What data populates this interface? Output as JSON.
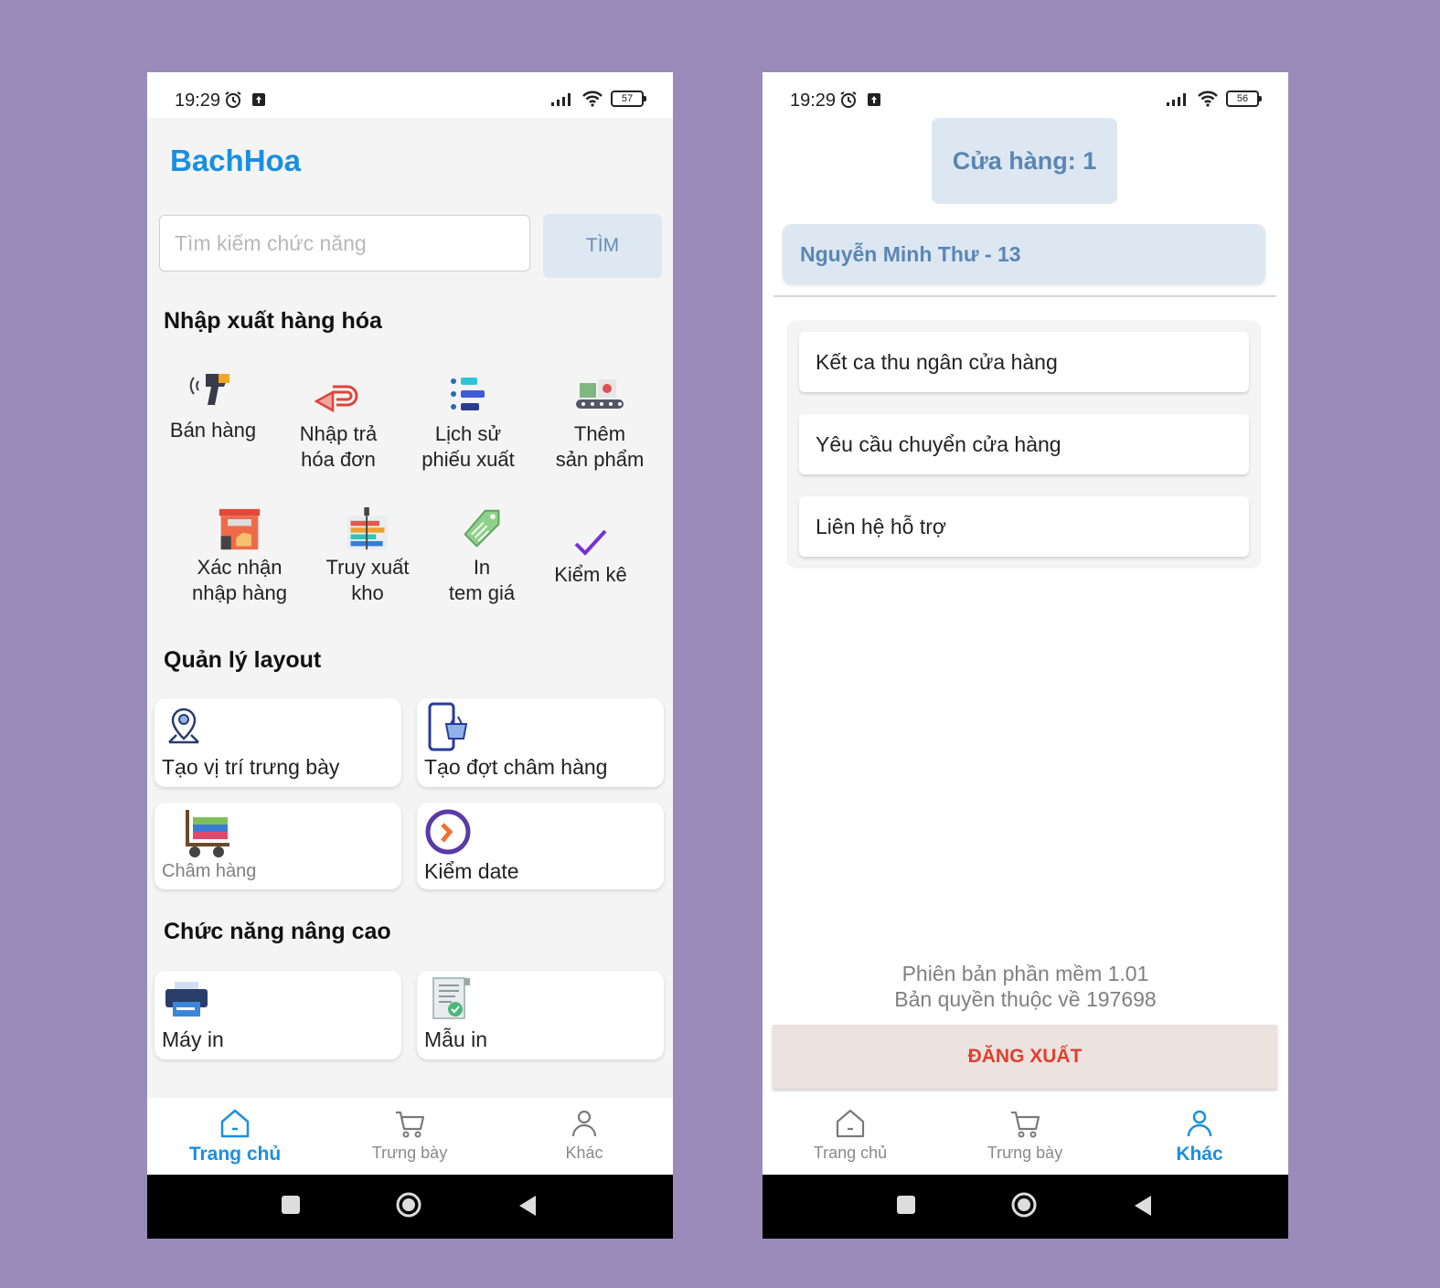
{
  "screens": {
    "home": {
      "status": {
        "time": "19:29",
        "battery": "57"
      },
      "app_title": "BachHoa",
      "search": {
        "placeholder": "Tìm kiếm chức năng",
        "button_label": "TÌM"
      },
      "sections": {
        "import_export": {
          "title": "Nhập xuất hàng hóa",
          "items": [
            {
              "label": "Bán hàng",
              "icon": "barcode-scanner-icon"
            },
            {
              "label": "Nhập trả\nhóa đơn",
              "icon": "return-arrow-icon"
            },
            {
              "label": "Lịch sử\nphiếu xuất",
              "icon": "history-list-icon"
            },
            {
              "label": "Thêm\nsản phẩm",
              "icon": "conveyor-icon"
            },
            {
              "label": "Xác nhận\nnhập hàng",
              "icon": "warehouse-icon"
            },
            {
              "label": "Truy xuất\nkho",
              "icon": "shelf-icon"
            },
            {
              "label": "In\ntem giá",
              "icon": "price-tag-icon"
            },
            {
              "label": "Kiểm kê",
              "icon": "checkmark-icon"
            }
          ]
        },
        "layout": {
          "title": "Quản lý layout",
          "cards": [
            {
              "label": "Tạo vị trí trưng bày",
              "icon": "map-pin-user-icon"
            },
            {
              "label": "Tạo đợt châm hàng",
              "icon": "phone-basket-icon"
            },
            {
              "label": "Châm hàng",
              "icon": "hand-truck-icon"
            },
            {
              "label": "Kiểm date",
              "icon": "clock-icon"
            }
          ]
        },
        "advanced": {
          "title": "Chức năng nâng cao",
          "cards": [
            {
              "label": "Máy in",
              "icon": "printer-icon"
            },
            {
              "label": "Mẫu in",
              "icon": "receipt-template-icon"
            }
          ]
        }
      },
      "nav": [
        {
          "label": "Trang chủ",
          "icon": "home-icon",
          "active": true
        },
        {
          "label": "Trưng bày",
          "icon": "cart-icon",
          "active": false
        },
        {
          "label": "Khác",
          "icon": "user-icon",
          "active": false
        }
      ]
    },
    "other": {
      "status": {
        "time": "19:29",
        "battery": "56"
      },
      "store_label": "Cửa hàng: 1",
      "user_label": "Nguyễn Minh Thư - 13",
      "menu": [
        {
          "label": "Kết ca thu ngân cửa hàng"
        },
        {
          "label": "Yêu cầu chuyển cửa hàng"
        },
        {
          "label": "Liên hệ hỗ trợ"
        }
      ],
      "version_line1": "Phiên bản phần mềm 1.01",
      "version_line2": "Bản quyền thuộc về 197698",
      "logout_label": "ĐĂNG XUẤT",
      "nav": [
        {
          "label": "Trang chủ",
          "icon": "home-icon",
          "active": false
        },
        {
          "label": "Trưng bày",
          "icon": "cart-icon",
          "active": false
        },
        {
          "label": "Khác",
          "icon": "user-icon",
          "active": true
        }
      ]
    }
  },
  "colors": {
    "background": "#9a8bbb",
    "brand_blue": "#1a8fe0",
    "muted_blue_box": "#dce7f1",
    "logout_red": "#e04030"
  }
}
